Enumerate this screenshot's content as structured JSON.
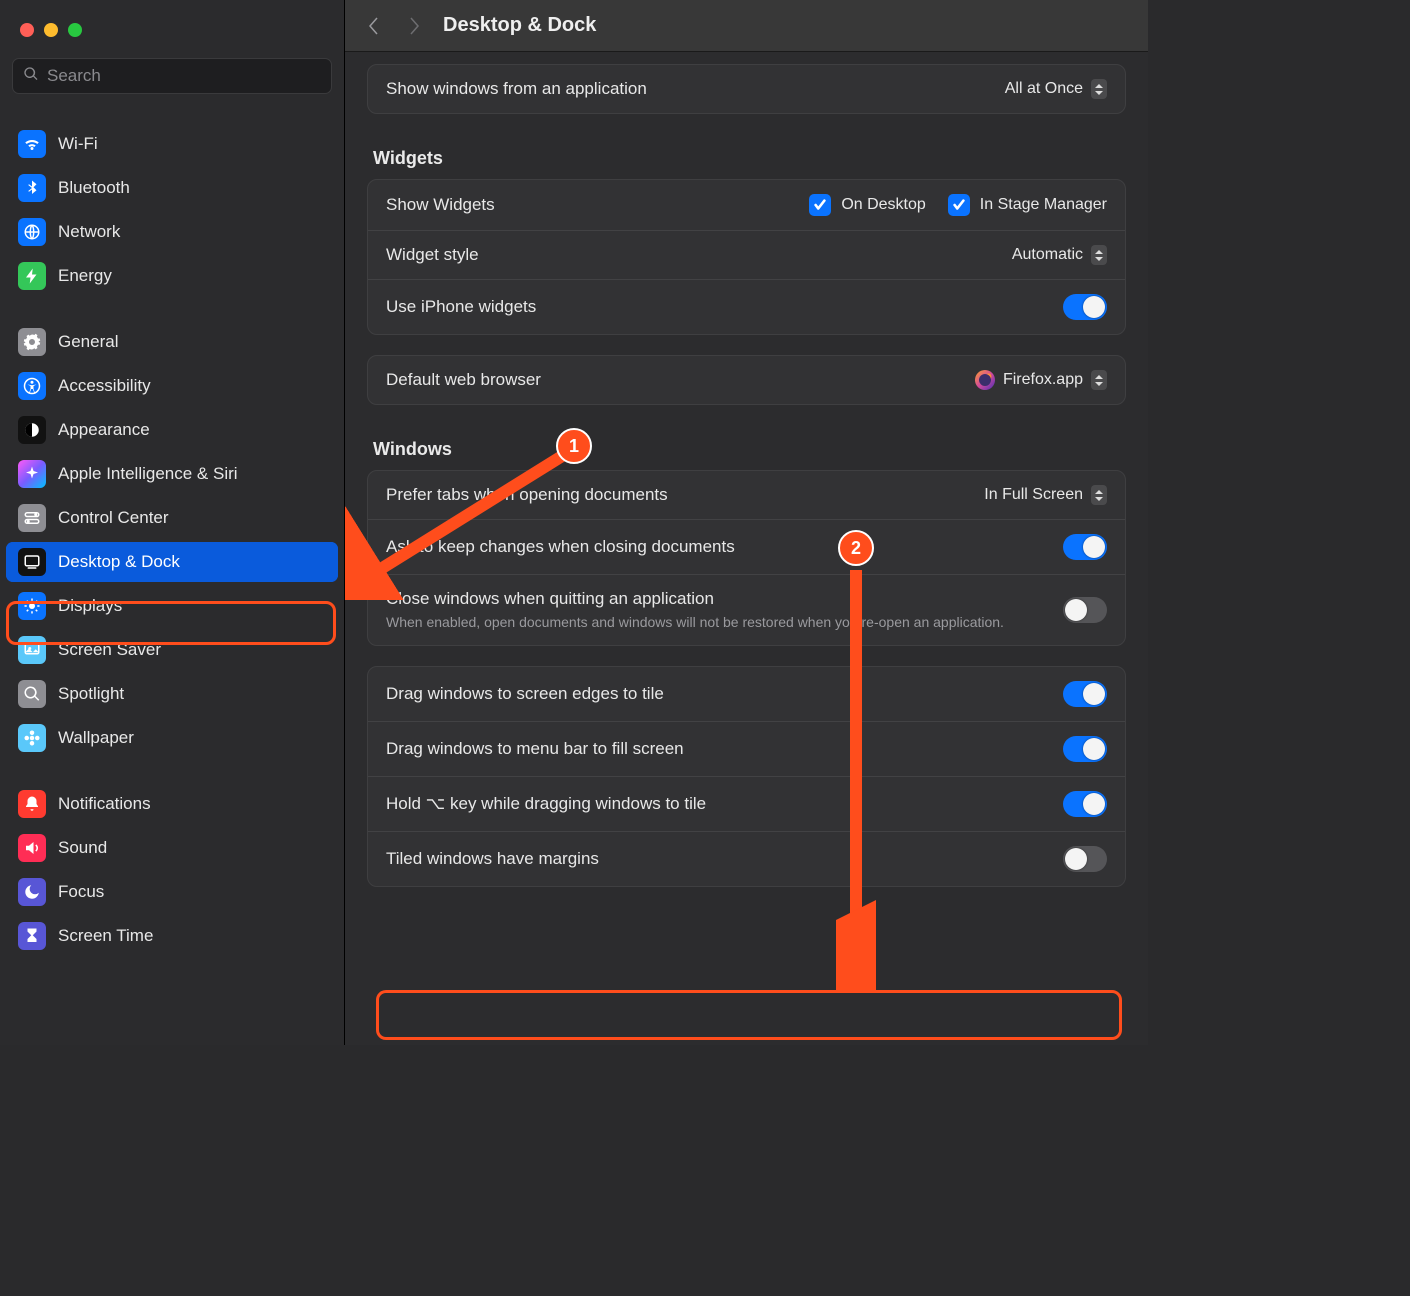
{
  "search": {
    "placeholder": "Search"
  },
  "sidebar": {
    "group1": [
      {
        "label": "Wi-Fi",
        "bg": "#0a73ff",
        "glyph": "wifi"
      },
      {
        "label": "Bluetooth",
        "bg": "#0a73ff",
        "glyph": "bluetooth"
      },
      {
        "label": "Network",
        "bg": "#0a73ff",
        "glyph": "globe"
      },
      {
        "label": "Energy",
        "bg": "#34c759",
        "glyph": "bolt"
      }
    ],
    "group2": [
      {
        "label": "General",
        "bg": "#8e8e93",
        "glyph": "gear"
      },
      {
        "label": "Accessibility",
        "bg": "#0a73ff",
        "glyph": "accessibility"
      },
      {
        "label": "Appearance",
        "bg": "#121212",
        "glyph": "appearance"
      },
      {
        "label": "Apple Intelligence & Siri",
        "bg": "linear-gradient(135deg,#ff5af7,#7a5cff,#00c2ff)",
        "glyph": "sparkle"
      },
      {
        "label": "Control Center",
        "bg": "#8e8e93",
        "glyph": "switches"
      },
      {
        "label": "Desktop & Dock",
        "bg": "#121212",
        "glyph": "dock",
        "active": true
      },
      {
        "label": "Displays",
        "bg": "#0a73ff",
        "glyph": "brightness"
      },
      {
        "label": "Screen Saver",
        "bg": "#5ac8fa",
        "glyph": "screensaver"
      },
      {
        "label": "Spotlight",
        "bg": "#8e8e93",
        "glyph": "search"
      },
      {
        "label": "Wallpaper",
        "bg": "#5ac8fa",
        "glyph": "flower"
      }
    ],
    "group3": [
      {
        "label": "Notifications",
        "bg": "#ff3b30",
        "glyph": "bell"
      },
      {
        "label": "Sound",
        "bg": "#ff2d55",
        "glyph": "speaker"
      },
      {
        "label": "Focus",
        "bg": "#5856d6",
        "glyph": "moon"
      },
      {
        "label": "Screen Time",
        "bg": "#5856d6",
        "glyph": "hourglass"
      }
    ]
  },
  "title": "Desktop & Dock",
  "topRow": {
    "label": "Show windows from an application",
    "value": "All at Once"
  },
  "widgets": {
    "section": "Widgets",
    "showWidgets": "Show Widgets",
    "onDesktop": "On Desktop",
    "inStageManager": "In Stage Manager",
    "widgetStyle": "Widget style",
    "widgetStyleValue": "Automatic",
    "useIphone": "Use iPhone widgets"
  },
  "browser": {
    "label": "Default web browser",
    "value": "Firefox.app"
  },
  "windows": {
    "section": "Windows",
    "preferTabs": "Prefer tabs when opening documents",
    "preferTabsValue": "In Full Screen",
    "askKeep": "Ask to keep changes when closing documents",
    "closeQuit": "Close windows when quitting an application",
    "closeQuitSub": "When enabled, open documents and windows will not be restored when you re-open an application.",
    "dragEdges": "Drag windows to screen edges to tile",
    "dragMenubar": "Drag windows to menu bar to fill screen",
    "holdOption": "Hold ⌥ key while dragging windows to tile",
    "tiledMargins": "Tiled windows have margins"
  },
  "annotations": {
    "badge1": "1",
    "badge2": "2"
  }
}
